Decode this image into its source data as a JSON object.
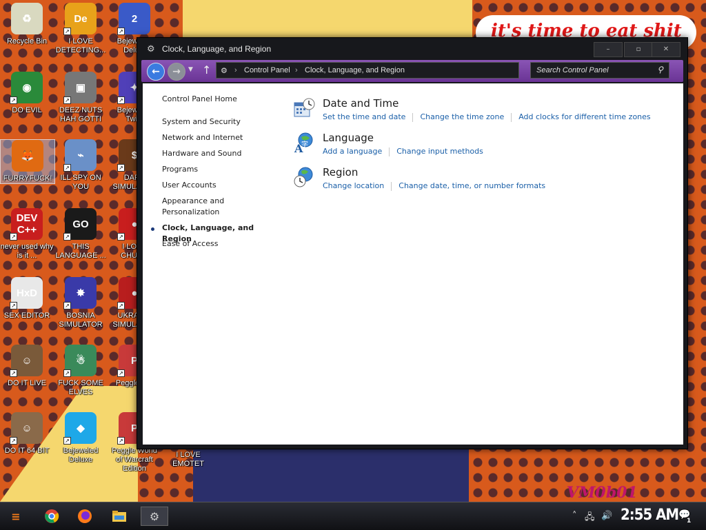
{
  "desktop": {
    "wallpaper_text": "it's time to eat shit",
    "wallpaper_sign": "VM0b01",
    "icons": [
      {
        "label": "Recycle Bin",
        "glyph": "♻",
        "color": "#d9d9c0"
      },
      {
        "label": "I LOVE DETECTING...",
        "glyph": "De",
        "color": "#e8a21a"
      },
      {
        "label": "Bejeweled Delu...",
        "glyph": "2",
        "color": "#3a5ac8"
      },
      {
        "label": "DO EVIL",
        "glyph": "◉",
        "color": "#2a8a3a"
      },
      {
        "label": "DEEZ NUTS HAH GOTTI",
        "glyph": "▣",
        "color": "#777"
      },
      {
        "label": "Bejeweled Twist",
        "glyph": "✦",
        "color": "#5040b8"
      },
      {
        "label": "FURRYFUCK!",
        "glyph": "🦊",
        "color": "#e06a12"
      },
      {
        "label": "ILL SPY ON YOU",
        "glyph": "⌁",
        "color": "#6a90c8"
      },
      {
        "label": "DARK SIMULATOR",
        "glyph": "$",
        "color": "#6a3a1a"
      },
      {
        "label": "never used why is it ...",
        "glyph": "DEV C++",
        "color": "#c81e1e"
      },
      {
        "label": "THIS LANGUAGE ...",
        "glyph": "GO",
        "color": "#1a1a1a"
      },
      {
        "label": "I LOVE CHUZ...",
        "glyph": "●",
        "color": "#c81e1e"
      },
      {
        "label": "SEX EDITOR",
        "glyph": "HxD",
        "color": "#e8e8e8"
      },
      {
        "label": "BOSNIA SIMULATOR",
        "glyph": "✸",
        "color": "#3a3aa8"
      },
      {
        "label": "UKRAINE SIMULATOR",
        "glyph": "●",
        "color": "#b81e1e"
      },
      {
        "label": "DO IT LIVE",
        "glyph": "☺",
        "color": "#7a5a3a"
      },
      {
        "label": "FUCK SOME ELVES",
        "glyph": "☃",
        "color": "#3a8a5a"
      },
      {
        "label": "Peggle D...",
        "glyph": "P",
        "color": "#c83a3a"
      },
      {
        "label": "DO IT 64 BIT",
        "glyph": "☺",
        "color": "#8a6a4a"
      },
      {
        "label": "Bejeweled Deluxe",
        "glyph": "◆",
        "color": "#1ea8e8"
      },
      {
        "label": "Peggle World of Warcraft Edition",
        "glyph": "P",
        "color": "#c83a3a"
      },
      {
        "label": "I LOVE EMOTET",
        "glyph": "",
        "color": ""
      }
    ]
  },
  "window": {
    "title": "Clock, Language, and Region",
    "buttons": {
      "minimize": "–",
      "maximize": "▫",
      "close": "✕"
    },
    "nav": {
      "back": "←",
      "forward": "→",
      "up": "↑",
      "breadcrumb": [
        "Control Panel",
        "Clock, Language, and Region"
      ],
      "search_placeholder": "Search Control Panel"
    },
    "sidebar": {
      "items": [
        "Control Panel Home",
        "System and Security",
        "Network and Internet",
        "Hardware and Sound",
        "Programs",
        "User Accounts",
        "Appearance and Personalization",
        "Clock, Language, and Region",
        "Ease of Access"
      ],
      "active_index": 7
    },
    "categories": [
      {
        "title": "Date and Time",
        "icon": "calendar-clock-icon",
        "links": [
          "Set the time and date",
          "Change the time zone",
          "Add clocks for different time zones"
        ]
      },
      {
        "title": "Language",
        "icon": "language-globe-icon",
        "links": [
          "Add a language",
          "Change input methods"
        ]
      },
      {
        "title": "Region",
        "icon": "region-globe-clock-icon",
        "links": [
          "Change location",
          "Change date, time, or number formats"
        ]
      }
    ]
  },
  "taskbar": {
    "clock": "2:55 AM",
    "notification_count": "1"
  }
}
